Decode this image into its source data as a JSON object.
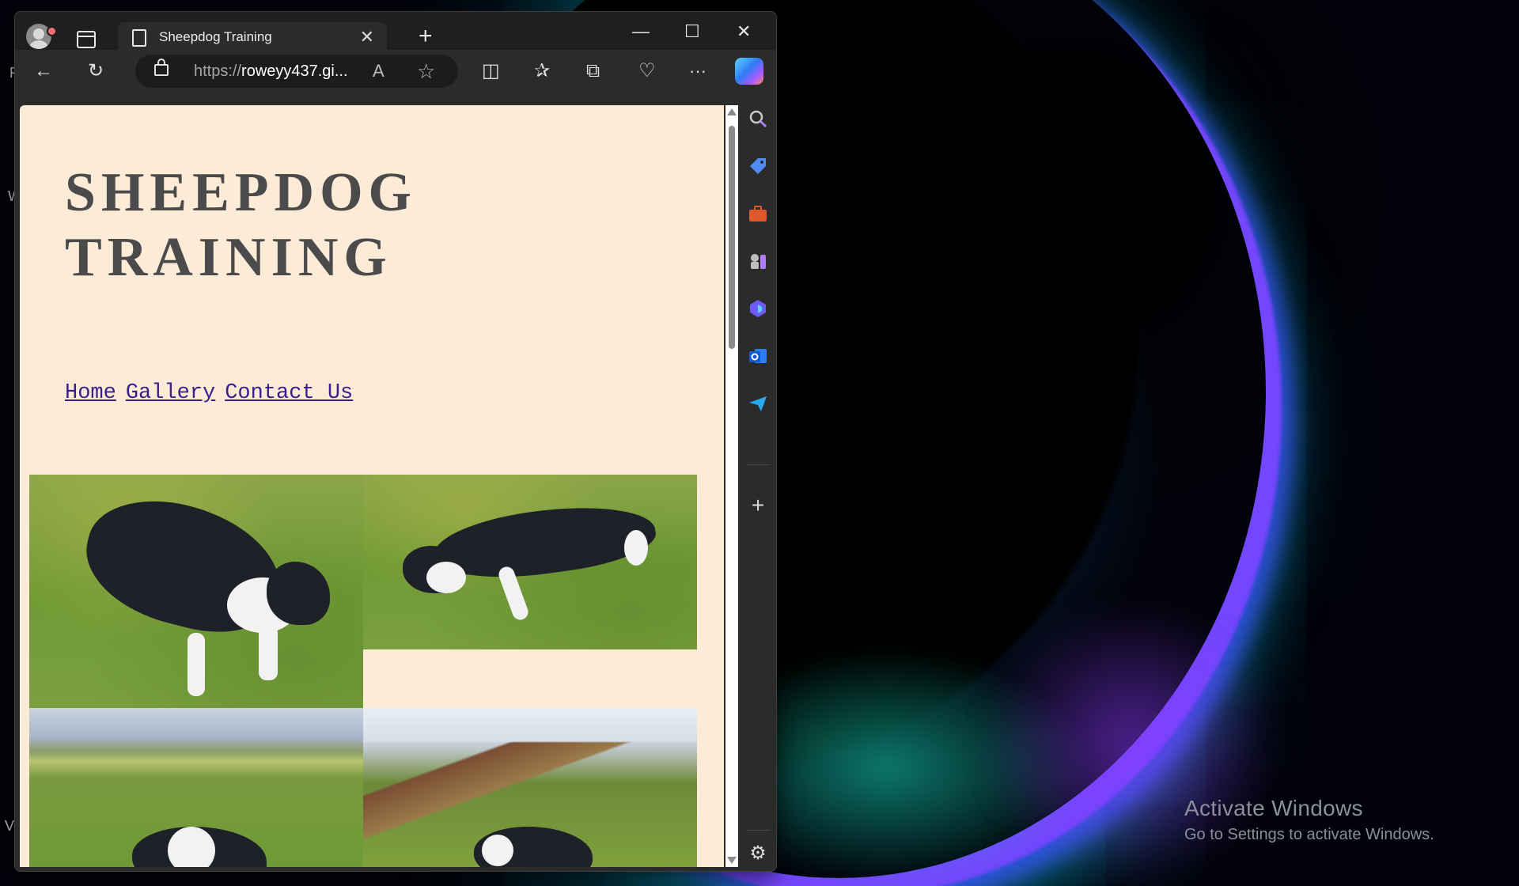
{
  "browser": {
    "tab_title": "Sheepdog Training",
    "url_prefix": "https://",
    "url_main": "roweyy437.gi...",
    "new_tab_label": "+",
    "read_aloud_label": "A",
    "controls": {
      "minimize": "—",
      "maximize": "☐",
      "close": "✕",
      "tab_close": "✕"
    },
    "toolbar_icons": [
      "back-arrow-icon",
      "refresh-icon",
      "split-screen-icon",
      "favorites-icon",
      "collections-icon",
      "browser-essentials-icon",
      "more-icon",
      "copilot-icon"
    ],
    "toolbar_glyphs": {
      "back": "←",
      "refresh": "↻",
      "split": "◫",
      "favorites": "✰",
      "collections": "⧉",
      "essentials": "♡",
      "more": "···",
      "star": "☆"
    }
  },
  "sidebar": {
    "items": [
      "search-icon",
      "shopping-tag-icon",
      "tools-icon",
      "games-icon",
      "m365-icon",
      "outlook-icon",
      "send-icon"
    ],
    "add_label": "+",
    "settings_label": "⚙"
  },
  "page": {
    "title_line1": "SHEEPDOG",
    "title_line2": "TRAINING",
    "nav": [
      "Home",
      "Gallery",
      "Contact Us"
    ]
  },
  "desktop": {
    "activate_title": "Activate Windows",
    "activate_sub": "Go to Settings to activate Windows.",
    "edge_letters": [
      "F",
      "W",
      "Ve"
    ]
  },
  "colors": {
    "page_background": "#fbebd7",
    "title_color": "#4b4b4b",
    "nav_link_color": "#3a1f8c",
    "chrome_dark": "#1f1f1f",
    "chrome": "#2b2b2b"
  }
}
